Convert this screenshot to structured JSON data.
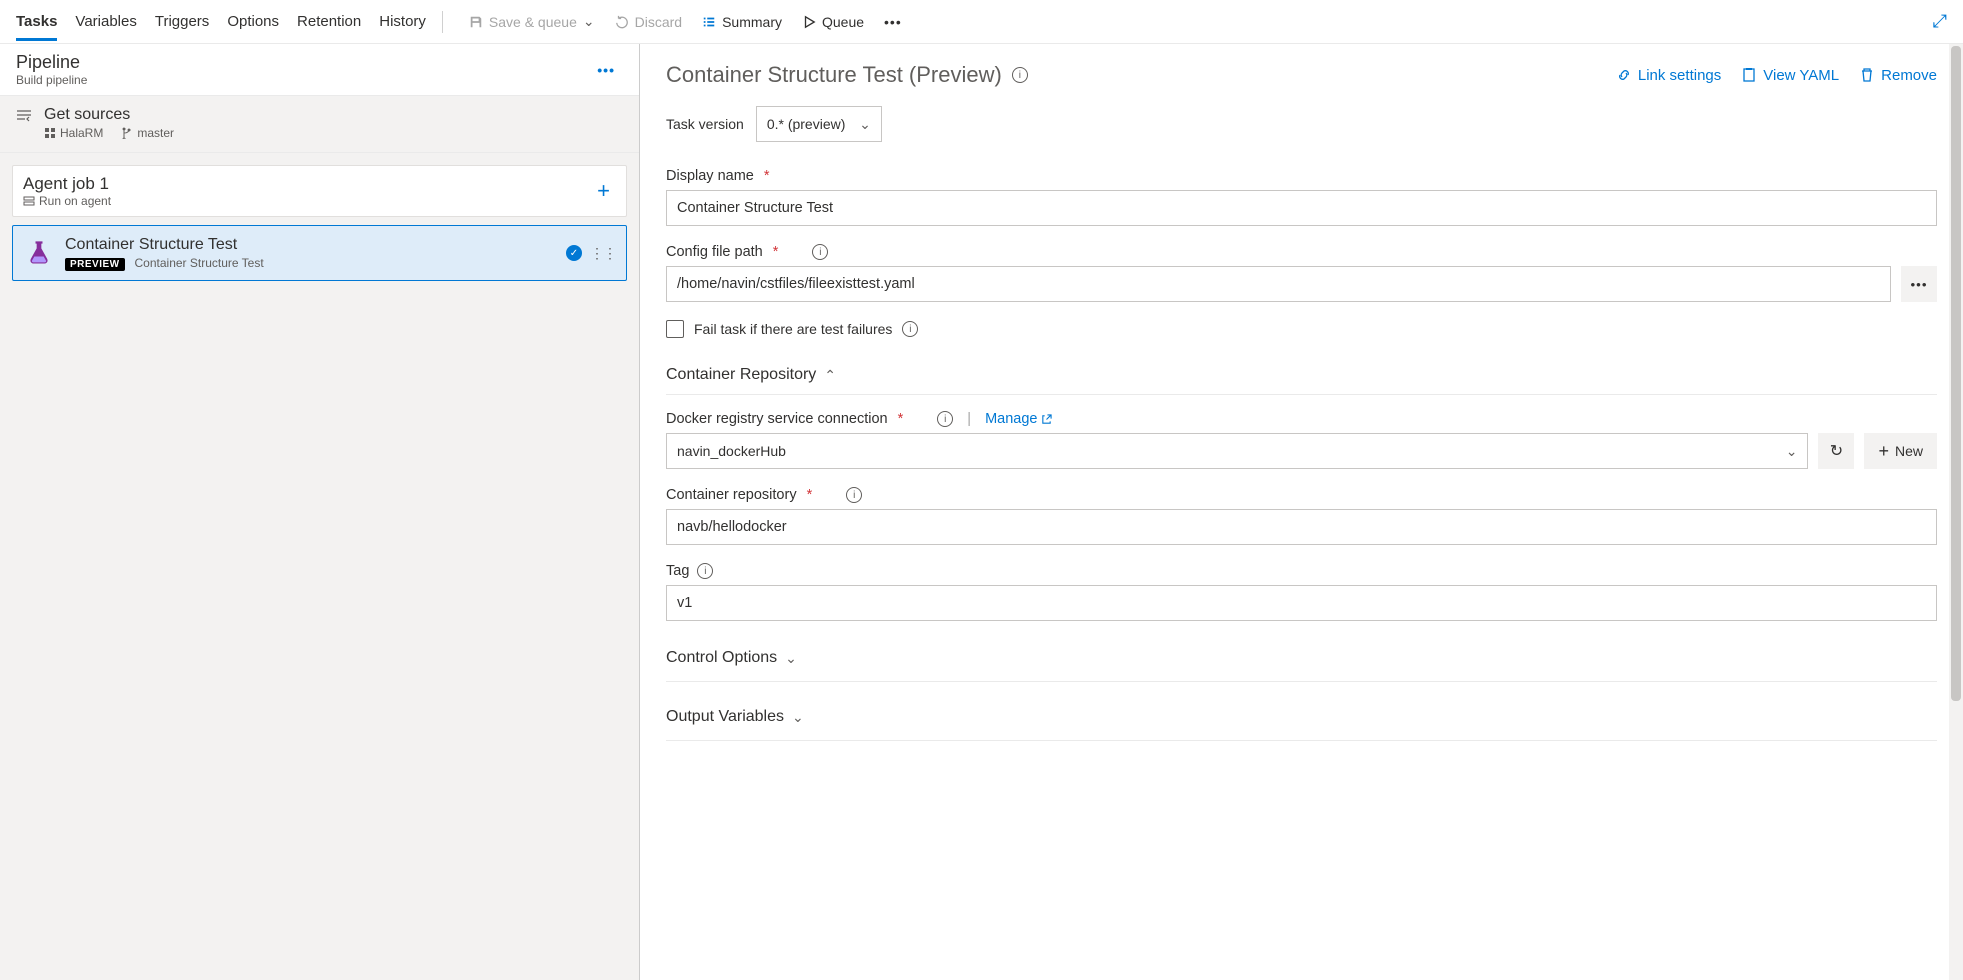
{
  "topTabs": [
    "Tasks",
    "Variables",
    "Triggers",
    "Options",
    "Retention",
    "History"
  ],
  "activeTab": "Tasks",
  "toolbar": {
    "saveQueue": "Save & queue",
    "discard": "Discard",
    "summary": "Summary",
    "queue": "Queue"
  },
  "pipeline": {
    "title": "Pipeline",
    "subtitle": "Build pipeline"
  },
  "sources": {
    "title": "Get sources",
    "repo": "HalaRM",
    "branch": "master"
  },
  "agentJob": {
    "title": "Agent job 1",
    "subtitle": "Run on agent"
  },
  "taskItem": {
    "title": "Container Structure Test",
    "badge": "PREVIEW",
    "subtitle": "Container Structure Test"
  },
  "rightHeader": {
    "title": "Container Structure Test (Preview)",
    "linkSettings": "Link settings",
    "viewYaml": "View YAML",
    "remove": "Remove"
  },
  "taskVersion": {
    "label": "Task version",
    "value": "0.* (preview)"
  },
  "displayName": {
    "label": "Display name",
    "value": "Container Structure Test"
  },
  "configPath": {
    "label": "Config file path",
    "value": "/home/navin/cstfiles/fileexisttest.yaml"
  },
  "failTask": {
    "label": "Fail task if there are test failures"
  },
  "sections": {
    "containerRepo": "Container Repository",
    "controlOptions": "Control Options",
    "outputVariables": "Output Variables"
  },
  "dockerConn": {
    "label": "Docker registry service connection",
    "manage": "Manage",
    "value": "navin_dockerHub",
    "newLabel": "New"
  },
  "containerRepoField": {
    "label": "Container repository",
    "value": "navb/hellodocker"
  },
  "tagField": {
    "label": "Tag",
    "value": "v1"
  }
}
